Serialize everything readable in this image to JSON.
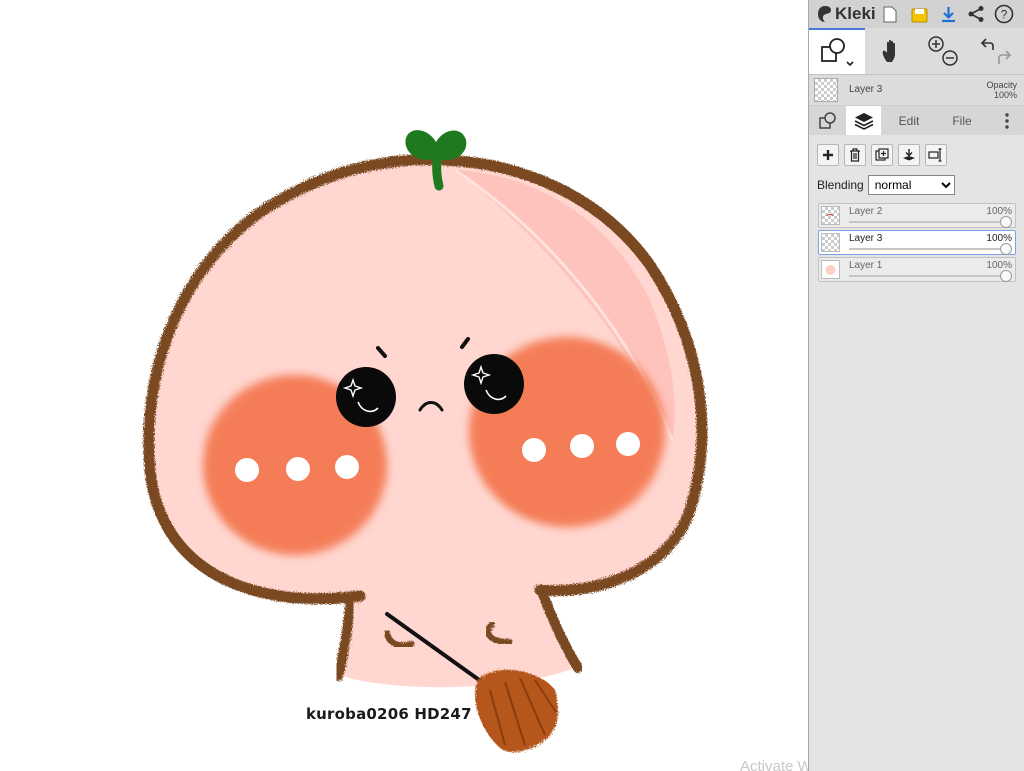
{
  "app": {
    "name": "Kleki"
  },
  "canvas": {
    "watermark": "kuroba0206 HD247",
    "os_overlay": "Activate Windows"
  },
  "toolbar_icons": [
    "new-image-icon",
    "save-icon",
    "download-icon",
    "share-icon",
    "help-icon"
  ],
  "tools": [
    "brush-tool-icon",
    "hand-tool-icon",
    "zoom-in-icon",
    "zoom-out-icon",
    "undo-icon",
    "redo-icon"
  ],
  "current_layer": {
    "name": "Layer 3",
    "opacity_label": "Opacity",
    "opacity_value": "100%"
  },
  "tabs": [
    {
      "id": "brush",
      "icon": "brush-tab-icon"
    },
    {
      "id": "layers",
      "icon": "layers-icon",
      "active": true
    },
    {
      "id": "edit",
      "label": "Edit"
    },
    {
      "id": "file",
      "label": "File"
    },
    {
      "id": "more",
      "icon": "more-vertical-icon"
    }
  ],
  "layer_actions": [
    "add-layer-icon",
    "delete-layer-icon",
    "duplicate-layer-icon",
    "merge-down-icon",
    "rename-layer-icon"
  ],
  "blending": {
    "label": "Blending",
    "selected": "normal"
  },
  "layers": [
    {
      "name": "Layer 2",
      "opacity": "100%",
      "opacity_value": 1.0,
      "active": false
    },
    {
      "name": "Layer 3",
      "opacity": "100%",
      "opacity_value": 1.0,
      "active": true
    },
    {
      "name": "Layer 1",
      "opacity": "100%",
      "opacity_value": 1.0,
      "active": false
    }
  ],
  "colors": {
    "accent": "#4a7ad9",
    "sidebar_bg": "#dcdcdc",
    "character_fill": "#ffd6d0",
    "outline": "#7a4a22",
    "blush": "#f26a3c",
    "leaf": "#1f7a1f",
    "broom": "#b5571a"
  }
}
